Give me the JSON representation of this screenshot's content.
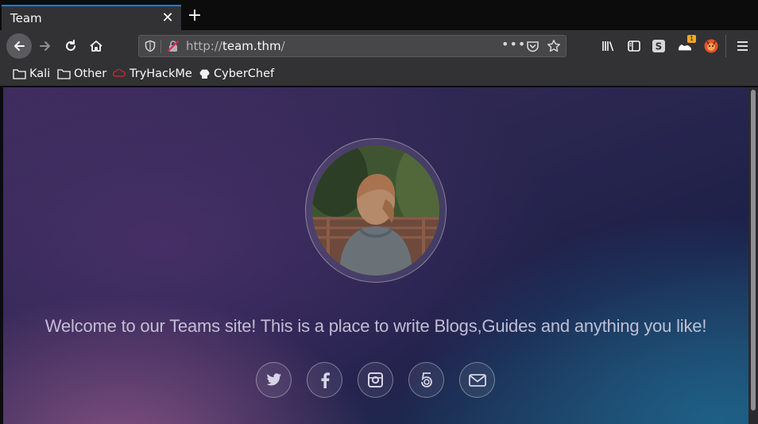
{
  "tab": {
    "title": "Team"
  },
  "urlbar": {
    "protocol": "http://",
    "host": "team.thm",
    "path": "/"
  },
  "toolbar": {
    "extension_badge": "1"
  },
  "bookmarks": [
    {
      "label": "Kali",
      "icon": "folder-icon"
    },
    {
      "label": "Other",
      "icon": "folder-icon"
    },
    {
      "label": "TryHackMe",
      "icon": "tryhackme-icon"
    },
    {
      "label": "CyberChef",
      "icon": "chef-hat-icon"
    }
  ],
  "page": {
    "welcome_text": "Welcome to our Teams site! This is a place to write Blogs,Guides and anything you like!",
    "socials": [
      "twitter-icon",
      "facebook-icon",
      "instagram-icon",
      "500px-icon",
      "mail-icon"
    ]
  },
  "colors": {
    "accent": "#0a84ff",
    "chrome": "#323234",
    "frame": "#0c0c0d"
  }
}
